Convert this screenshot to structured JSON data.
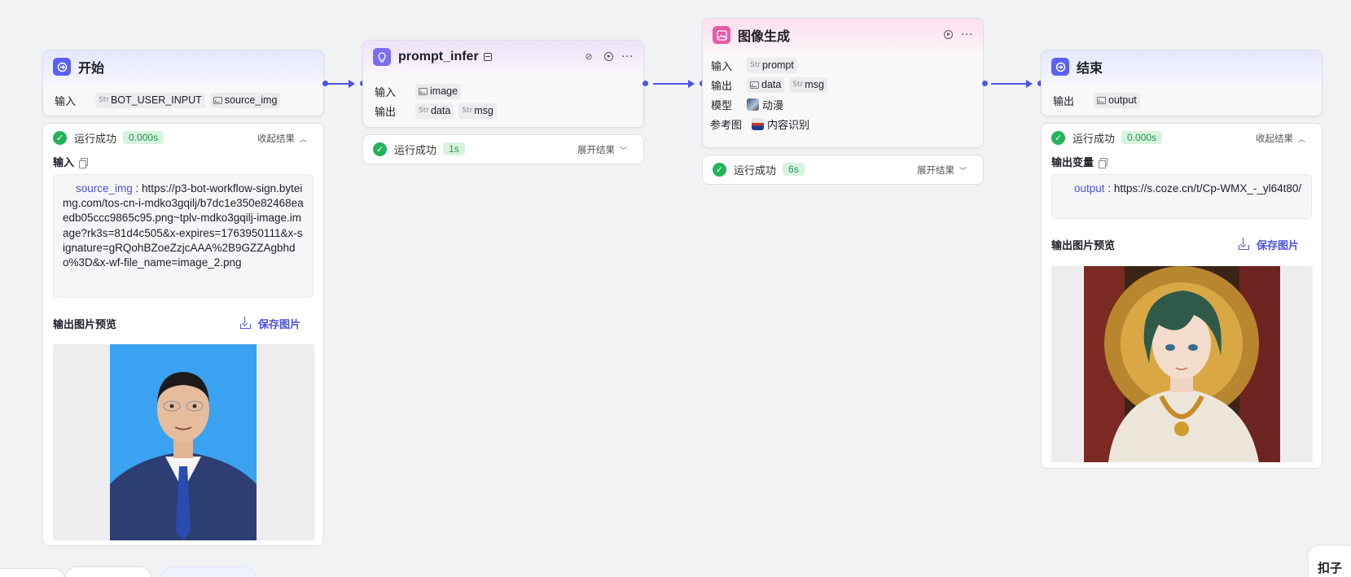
{
  "colors": {
    "accent": "#4d53e8",
    "success": "#23b45b",
    "canvas": "#f1f2f4"
  },
  "common": {
    "input_label": "输入",
    "output_label": "输出",
    "success_text": "运行成功",
    "collapse_label": "收起结果",
    "expand_label": "展开结果",
    "preview_title": "输出图片预览",
    "save_label": "保存图片"
  },
  "start_node": {
    "title": "开始",
    "icon": "enter-icon",
    "inputs": [
      {
        "type": "Str",
        "name": "BOT_USER_INPUT"
      },
      {
        "type": "Image",
        "name": "source_img"
      }
    ],
    "result": {
      "time": "0.000s",
      "section_label": "输入",
      "key": "source_img",
      "value": "https://p3-bot-workflow-sign.byteimg.com/tos-cn-i-mdko3gqilj/b7dc1e350e82468eaedb05ccc9865c95.png~tplv-mdko3gqilj-image.image?rk3s=81d4c505&x-expires=1763950111&x-signature=gRQohBZoeZzjcAAA%2B9GZZAgbhdo%3D&x-wf-file_name=image_2.png"
    }
  },
  "prompt_node": {
    "title": "prompt_infer",
    "icon": "bulb-icon",
    "inputs": [
      {
        "type": "Image",
        "name": "image"
      }
    ],
    "outputs": [
      {
        "type": "Str",
        "name": "data"
      },
      {
        "type": "Str",
        "name": "msg"
      }
    ],
    "result": {
      "time": "1s"
    }
  },
  "image_node": {
    "title": "图像生成",
    "icon": "image-gen-icon",
    "inputs": [
      {
        "type": "Str",
        "name": "prompt"
      }
    ],
    "outputs": [
      {
        "type": "Image",
        "name": "data"
      },
      {
        "type": "Str",
        "name": "msg"
      }
    ],
    "model_label": "模型",
    "model_value": "动漫",
    "ref_label": "参考图",
    "ref_value": "内容识别",
    "result": {
      "time": "6s"
    }
  },
  "end_node": {
    "title": "结束",
    "icon": "exit-icon",
    "outputs": [
      {
        "type": "Image",
        "name": "output"
      }
    ],
    "result": {
      "time": "0.000s",
      "section_label": "输出变量",
      "key": "output",
      "value": "https://s.coze.cn/t/Cp-WMX_-_yl64t80/"
    }
  },
  "corner_badge": "扣子"
}
